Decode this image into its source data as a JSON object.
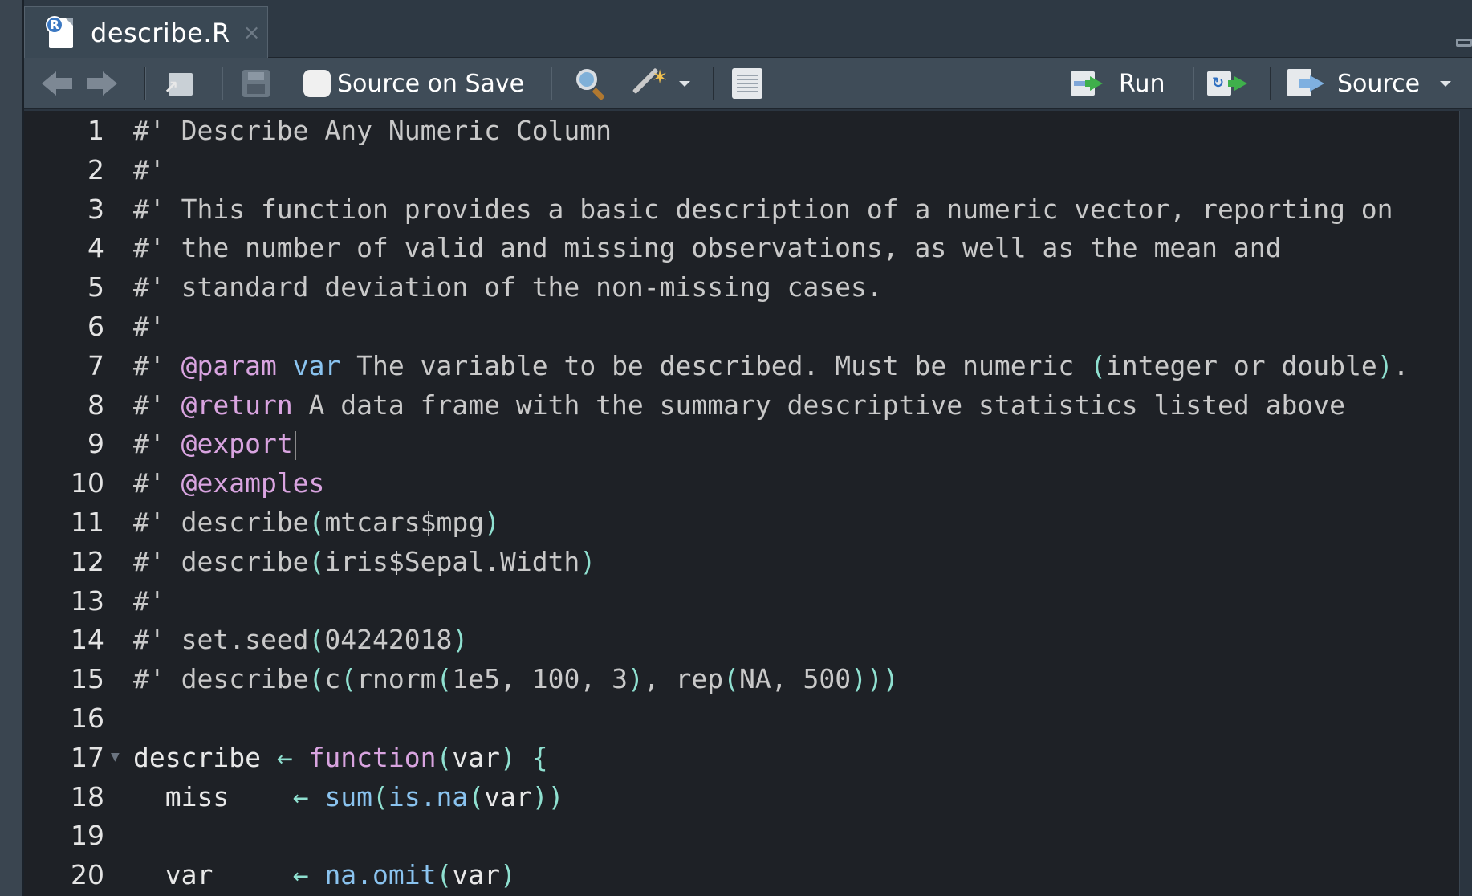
{
  "tab": {
    "title": "describe.R",
    "close": "×"
  },
  "toolbar": {
    "source_on_save_label": "Source on Save",
    "run_label": "Run",
    "source_label": "Source"
  },
  "editor": {
    "lines": [
      {
        "num": "1",
        "tokens": [
          {
            "t": "#' Describe Any Numeric Column",
            "c": "cm"
          }
        ]
      },
      {
        "num": "2",
        "tokens": [
          {
            "t": "#'",
            "c": "cm"
          }
        ]
      },
      {
        "num": "3",
        "tokens": [
          {
            "t": "#' This function provides a basic description of a numeric vector, reporting on",
            "c": "cm"
          }
        ]
      },
      {
        "num": "4",
        "tokens": [
          {
            "t": "#' the number of valid and missing observations, as well as the mean and",
            "c": "cm"
          }
        ]
      },
      {
        "num": "5",
        "tokens": [
          {
            "t": "#' standard deviation of the non-missing cases.",
            "c": "cm"
          }
        ]
      },
      {
        "num": "6",
        "tokens": [
          {
            "t": "#'",
            "c": "cm"
          }
        ]
      },
      {
        "num": "7",
        "tokens": [
          {
            "t": "#' ",
            "c": "cm"
          },
          {
            "t": "@param",
            "c": "tag"
          },
          {
            "t": " var",
            "c": "var"
          },
          {
            "t": " The variable to be described. Must be numeric ",
            "c": "cm"
          },
          {
            "t": "(",
            "c": "paren"
          },
          {
            "t": "integer or double",
            "c": "cm"
          },
          {
            "t": ")",
            "c": "paren"
          },
          {
            "t": ".",
            "c": "cm"
          }
        ]
      },
      {
        "num": "8",
        "tokens": [
          {
            "t": "#' ",
            "c": "cm"
          },
          {
            "t": "@return",
            "c": "tag"
          },
          {
            "t": " A data frame with the summary descriptive statistics listed above",
            "c": "cm"
          }
        ]
      },
      {
        "num": "9",
        "tokens": [
          {
            "t": "#' ",
            "c": "cm"
          },
          {
            "t": "@export",
            "c": "tag"
          }
        ],
        "cursor": true
      },
      {
        "num": "10",
        "tokens": [
          {
            "t": "#' ",
            "c": "cm"
          },
          {
            "t": "@examples",
            "c": "tag"
          }
        ]
      },
      {
        "num": "11",
        "tokens": [
          {
            "t": "#' describe",
            "c": "cm"
          },
          {
            "t": "(",
            "c": "paren"
          },
          {
            "t": "mtcars$mpg",
            "c": "cm"
          },
          {
            "t": ")",
            "c": "paren"
          }
        ]
      },
      {
        "num": "12",
        "tokens": [
          {
            "t": "#' describe",
            "c": "cm"
          },
          {
            "t": "(",
            "c": "paren"
          },
          {
            "t": "iris$Sepal.Width",
            "c": "cm"
          },
          {
            "t": ")",
            "c": "paren"
          }
        ]
      },
      {
        "num": "13",
        "tokens": [
          {
            "t": "#'",
            "c": "cm"
          }
        ]
      },
      {
        "num": "14",
        "tokens": [
          {
            "t": "#' set.seed",
            "c": "cm"
          },
          {
            "t": "(",
            "c": "paren"
          },
          {
            "t": "04242018",
            "c": "cm"
          },
          {
            "t": ")",
            "c": "paren"
          }
        ]
      },
      {
        "num": "15",
        "tokens": [
          {
            "t": "#' describe",
            "c": "cm"
          },
          {
            "t": "(",
            "c": "paren"
          },
          {
            "t": "c",
            "c": "cm"
          },
          {
            "t": "(",
            "c": "paren"
          },
          {
            "t": "rnorm",
            "c": "cm"
          },
          {
            "t": "(",
            "c": "paren"
          },
          {
            "t": "1e5, 100, 3",
            "c": "cm"
          },
          {
            "t": ")",
            "c": "paren"
          },
          {
            "t": ", rep",
            "c": "cm"
          },
          {
            "t": "(",
            "c": "paren"
          },
          {
            "t": "NA, 500",
            "c": "cm"
          },
          {
            "t": ")))",
            "c": "paren"
          }
        ]
      },
      {
        "num": "16",
        "tokens": []
      },
      {
        "num": "17",
        "fold": true,
        "tokens": [
          {
            "t": "describe ",
            "c": "plain"
          },
          {
            "t": "←",
            "c": "op"
          },
          {
            "t": " ",
            "c": "plain"
          },
          {
            "t": "function",
            "c": "kw"
          },
          {
            "t": "(",
            "c": "paren"
          },
          {
            "t": "var",
            "c": "plain"
          },
          {
            "t": ")",
            "c": "paren"
          },
          {
            "t": " ",
            "c": "plain"
          },
          {
            "t": "{",
            "c": "paren"
          }
        ]
      },
      {
        "num": "18",
        "tokens": [
          {
            "t": "  miss    ",
            "c": "plain"
          },
          {
            "t": "←",
            "c": "op"
          },
          {
            "t": " ",
            "c": "plain"
          },
          {
            "t": "sum",
            "c": "fn"
          },
          {
            "t": "(",
            "c": "paren"
          },
          {
            "t": "is.na",
            "c": "fn"
          },
          {
            "t": "(",
            "c": "paren"
          },
          {
            "t": "var",
            "c": "plain"
          },
          {
            "t": "))",
            "c": "paren"
          }
        ]
      },
      {
        "num": "19",
        "tokens": []
      },
      {
        "num": "20",
        "tokens": [
          {
            "t": "  var     ",
            "c": "plain"
          },
          {
            "t": "←",
            "c": "op"
          },
          {
            "t": " ",
            "c": "plain"
          },
          {
            "t": "na.omit",
            "c": "fn"
          },
          {
            "t": "(",
            "c": "paren"
          },
          {
            "t": "var",
            "c": "plain"
          },
          {
            "t": ")",
            "c": "paren"
          }
        ]
      }
    ]
  },
  "colors": {
    "editor_bg": "#1e2126",
    "comment": "#c9c9c9",
    "roxygen_tag": "#d9a4e0",
    "function_name": "#8ac3ef",
    "paren": "#8fe0d0",
    "accent_green": "#3fb04b"
  }
}
